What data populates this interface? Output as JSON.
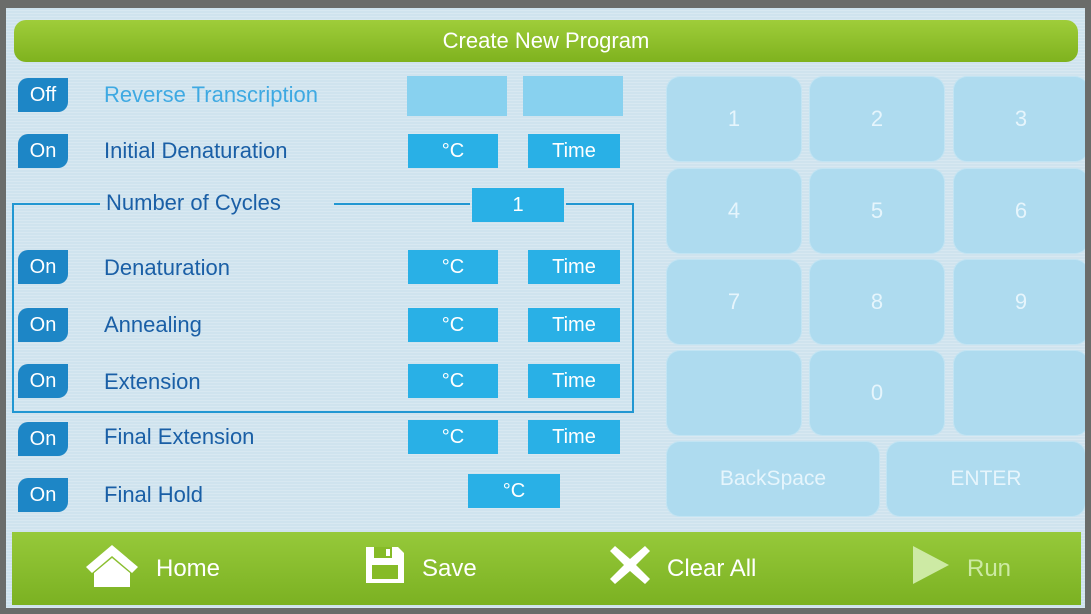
{
  "header": {
    "title": "Create New Program"
  },
  "steps": [
    {
      "toggle": "Off",
      "label": "Reverse Transcription",
      "temp": "",
      "time": ""
    },
    {
      "toggle": "On",
      "label": "Initial Denaturation",
      "temp": "°C",
      "time": "Time"
    },
    {
      "toggle": "On",
      "label": "Denaturation",
      "temp": "°C",
      "time": "Time"
    },
    {
      "toggle": "On",
      "label": "Annealing",
      "temp": "°C",
      "time": "Time"
    },
    {
      "toggle": "On",
      "label": "Extension",
      "temp": "°C",
      "time": "Time"
    },
    {
      "toggle": "On",
      "label": "Final Extension",
      "temp": "°C",
      "time": "Time"
    },
    {
      "toggle": "On",
      "label": "Final Hold",
      "temp": "°C"
    }
  ],
  "cycles": {
    "label": "Number of Cycles",
    "value": "1"
  },
  "keypad": {
    "keys": [
      "1",
      "2",
      "3",
      "4",
      "5",
      "6",
      "7",
      "8",
      "9",
      "",
      "0",
      ""
    ],
    "backspace": "BackSpace",
    "enter": "ENTER"
  },
  "footer": {
    "home": "Home",
    "save": "Save",
    "clear": "Clear All",
    "run": "Run"
  },
  "colors": {
    "accent_green": "#8bc02b",
    "toggle_blue": "#1d86c6",
    "field_blue": "#29b0e6",
    "label_blue": "#1a5fa6"
  }
}
